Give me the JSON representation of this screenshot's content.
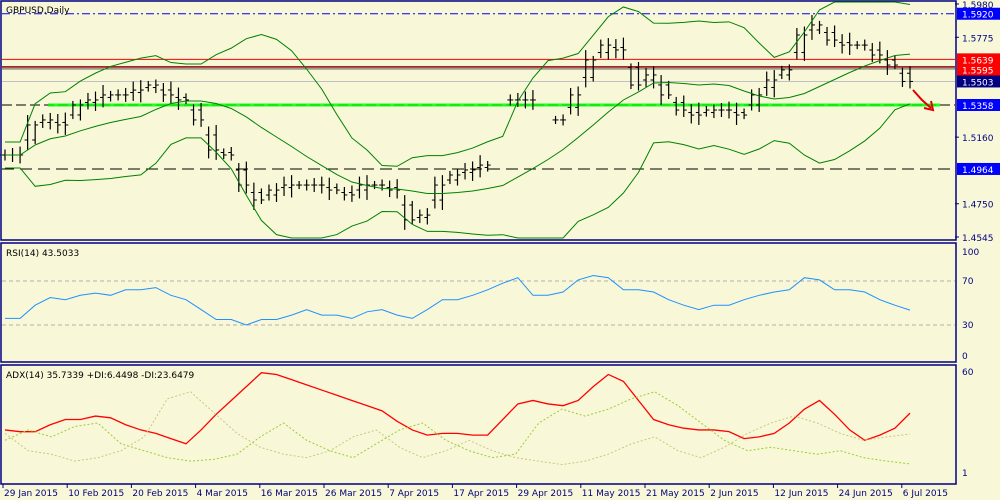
{
  "window": {
    "title": "GBPUSD,Daily"
  },
  "colors": {
    "background": "#F8F8D8",
    "frame": "#000080",
    "bars": "#000000",
    "bollinger": "#008000",
    "rsi": "#1E90FF",
    "adx": "#FF0000",
    "plus_di": "#9ACD32",
    "minus_di": "#9ACD32",
    "support": "#00FF00",
    "resistance": "#FF0000",
    "label_blue": "#0000FF",
    "label_navy": "#000080"
  },
  "chart_data": [
    {
      "type": "line",
      "title": "GBPUSD,Daily",
      "series_type": "ohlc-bars",
      "ylim": [
        1.4545,
        1.598
      ],
      "yticks": [
        "1.5980",
        "1.5775",
        "1.5160",
        "1.4750",
        "1.4545"
      ],
      "xlabels": [
        "29 Jan 2015",
        "10 Feb 2015",
        "20 Feb 2015",
        "4 Mar 2015",
        "16 Mar 2015",
        "26 Mar 2015",
        "7 Apr 2015",
        "17 Apr 2015",
        "29 Apr 2015",
        "11 May 2015",
        "21 May 2015",
        "2 Jun 2015",
        "12 Jun 2015",
        "24 Jun 2015",
        "6 Jul 2015"
      ],
      "closes": [
        1.505,
        1.505,
        1.5235,
        1.5266,
        1.5235,
        1.5358,
        1.5389,
        1.542,
        1.542,
        1.545,
        1.5481,
        1.542,
        1.5389,
        1.5266,
        1.5081,
        1.505,
        1.4865,
        1.4773,
        1.4834,
        1.4865,
        1.4865,
        1.4865,
        1.4834,
        1.4804,
        1.4865,
        1.4865,
        1.4834,
        1.465,
        1.468,
        1.4865,
        1.4927,
        1.4958,
        1.4988,
        null,
        1.5389,
        1.5389,
        null,
        1.5266,
        1.542,
        1.5635,
        1.5727,
        1.5697,
        1.5481,
        1.5543,
        1.542,
        1.5327,
        1.5296,
        1.5327,
        1.5327,
        1.5296,
        1.542,
        1.5512,
        1.5574,
        1.5789,
        1.5851,
        1.5758,
        1.5727,
        1.5727,
        1.5666,
        1.5604,
        1.5503
      ],
      "levels": [
        {
          "price": "1.5920",
          "style": "dash-dot",
          "color": "#0000FF",
          "label_bg": "#0000FF"
        },
        {
          "price": "1.5639",
          "style": "solid",
          "color": "#FF0000",
          "label_bg": "#FF0000"
        },
        {
          "price": "1.5595",
          "style": "solid",
          "color": "#FF0000",
          "label_bg": "#FF0000"
        },
        {
          "price": "1.5503",
          "style": "solid",
          "color": "#C0C0C0",
          "label_bg": "#000080"
        },
        {
          "price": "1.5358",
          "style": "support",
          "color": "#00FF00",
          "label_bg": "#0000FF"
        },
        {
          "price": "1.4964",
          "style": "dashed",
          "color": "#000000",
          "label_bg": "#0000FF"
        }
      ],
      "annotation": "red-down-arrow"
    },
    {
      "type": "line",
      "title": "RSI(14) 43.5033",
      "ylim": [
        0,
        100
      ],
      "yticks": [
        "100",
        "70",
        "30",
        "0"
      ],
      "levels": [
        70,
        30
      ],
      "values": [
        36,
        36,
        48,
        55,
        53,
        57,
        59,
        57,
        62,
        62,
        64,
        57,
        53,
        44,
        35,
        35,
        30,
        35,
        35,
        39,
        44,
        39,
        39,
        36,
        42,
        44,
        39,
        36,
        44,
        53,
        53,
        57,
        62,
        68,
        73,
        57,
        57,
        60,
        71,
        75,
        73,
        62,
        62,
        60,
        53,
        48,
        44,
        48,
        48,
        53,
        57,
        60,
        62,
        73,
        71,
        62,
        62,
        60,
        53,
        48,
        43.5
      ]
    },
    {
      "type": "line",
      "title": "ADX(14) 35.7339 +DI:6.4498 -DI:23.6479",
      "ylim": [
        0,
        60
      ],
      "yticks": [
        "60",
        "1"
      ],
      "series": [
        {
          "name": "ADX",
          "values": [
            26,
            25,
            25,
            29,
            32,
            32,
            34,
            33,
            29,
            26,
            24,
            21,
            18,
            26,
            35,
            43,
            51,
            59,
            58,
            55,
            52,
            49,
            46,
            43,
            40,
            37,
            31,
            26,
            23,
            24,
            24,
            23,
            23,
            32,
            41,
            43,
            41,
            40,
            43,
            51,
            58,
            54,
            43,
            32,
            29,
            27,
            26,
            26,
            25,
            21,
            22,
            24,
            30,
            38,
            43,
            35,
            26,
            20,
            23,
            27,
            35.7
          ]
        },
        {
          "name": "+DI",
          "values": [
            20,
            26,
            22,
            28,
            30,
            18,
            14,
            10,
            8,
            9,
            12,
            22,
            30,
            20,
            14,
            10,
            18,
            26,
            30,
            20,
            14,
            10,
            12,
            30,
            38,
            34,
            38,
            44,
            48,
            40,
            30,
            20,
            14,
            16,
            14,
            12,
            14,
            10,
            8,
            6.4
          ]
        },
        {
          "name": "-DI",
          "values": [
            24,
            14,
            12,
            8,
            10,
            14,
            22,
            44,
            48,
            36,
            24,
            16,
            12,
            10,
            14,
            22,
            26,
            16,
            10,
            14,
            20,
            14,
            10,
            8,
            6,
            8,
            12,
            18,
            22,
            14,
            10,
            16,
            24,
            30,
            34,
            30,
            24,
            20,
            22,
            23.6
          ]
        }
      ]
    }
  ]
}
